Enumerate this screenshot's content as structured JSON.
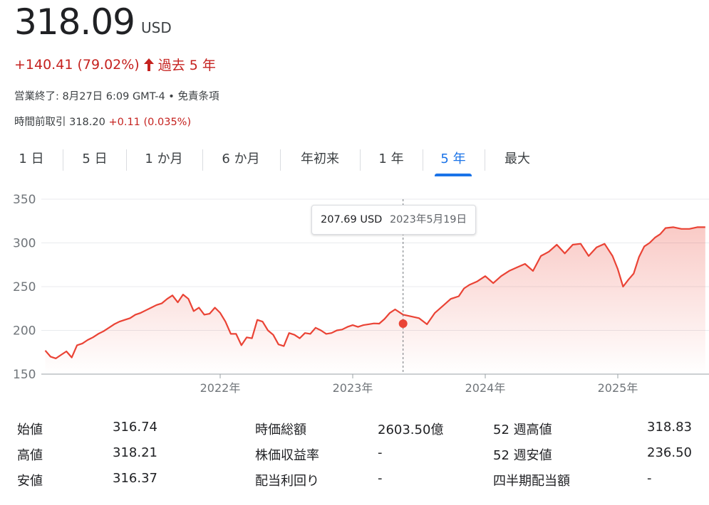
{
  "quote": {
    "price": "318.09",
    "currency": "USD",
    "change": "+140.41 (79.02%)",
    "period": "過去 5 年",
    "status": "営業終了: 8月27日 6:09 GMT-4 • 免責条項",
    "premarket_label": "時間前取引 318.20",
    "premarket_change": "+0.11 (0.035%)",
    "accent_up": "#c5221f"
  },
  "tabs": [
    {
      "label": "1 日"
    },
    {
      "label": "5 日"
    },
    {
      "label": "1 か月"
    },
    {
      "label": "6 か月"
    },
    {
      "label": "年初来"
    },
    {
      "label": "1 年"
    },
    {
      "label": "5 年",
      "active": true
    },
    {
      "label": "最大"
    }
  ],
  "tooltip": {
    "value": "207.69 USD",
    "date": "2023年5月19日"
  },
  "chart_data": {
    "type": "area",
    "x_tick_labels": [
      "2022年",
      "2023年",
      "2024年",
      "2025年"
    ],
    "y_tick_labels": [
      "350",
      "300",
      "250",
      "200",
      "150"
    ],
    "ylim": [
      150,
      350
    ],
    "grid": true,
    "line_color": "#ea4335",
    "highlight": {
      "x": 2023.38,
      "y": 207.69
    },
    "series": [
      {
        "x": [
          2020.68,
          2020.72,
          2020.76,
          2020.8,
          2020.84,
          2020.88,
          2020.92,
          2020.96,
          2021.0,
          2021.04,
          2021.08,
          2021.12,
          2021.16,
          2021.2,
          2021.24,
          2021.28,
          2021.32,
          2021.36,
          2021.4,
          2021.44,
          2021.48,
          2021.52,
          2021.56,
          2021.6,
          2021.64,
          2021.68,
          2021.72,
          2021.76,
          2021.8,
          2021.84,
          2021.88,
          2021.92,
          2021.96,
          2022.0,
          2022.04,
          2022.08,
          2022.12,
          2022.16,
          2022.2,
          2022.24,
          2022.28,
          2022.32,
          2022.36,
          2022.4,
          2022.44,
          2022.48,
          2022.52,
          2022.56,
          2022.6,
          2022.64,
          2022.68,
          2022.72,
          2022.76,
          2022.8,
          2022.84,
          2022.88,
          2022.92,
          2022.96,
          2023.0,
          2023.04,
          2023.08,
          2023.12,
          2023.16,
          2023.2,
          2023.24,
          2023.28,
          2023.32,
          2023.38,
          2023.44,
          2023.5,
          2023.56,
          2023.62,
          2023.68,
          2023.74,
          2023.8,
          2023.84,
          2023.88,
          2023.94,
          2024.0,
          2024.06,
          2024.12,
          2024.18,
          2024.24,
          2024.3,
          2024.36,
          2024.42,
          2024.48,
          2024.54,
          2024.6,
          2024.66,
          2024.72,
          2024.78,
          2024.84,
          2024.9,
          2024.96,
          2025.0,
          2025.04,
          2025.08,
          2025.12,
          2025.16,
          2025.2,
          2025.24,
          2025.28,
          2025.32,
          2025.36,
          2025.42,
          2025.48,
          2025.54,
          2025.6,
          2025.66
        ],
        "y": [
          177,
          170,
          168,
          172,
          176,
          169,
          183,
          185,
          189,
          192,
          196,
          199,
          203,
          207,
          210,
          212,
          214,
          218,
          220,
          223,
          226,
          229,
          231,
          236,
          240,
          232,
          241,
          236,
          222,
          226,
          218,
          219,
          226,
          220,
          210,
          196,
          196,
          183,
          192,
          191,
          212,
          210,
          200,
          195,
          184,
          182,
          197,
          195,
          191,
          197,
          196,
          203,
          200,
          196,
          197,
          200,
          201,
          204,
          206,
          204,
          206,
          207,
          208,
          207.69,
          213,
          220,
          224,
          218,
          216,
          214,
          207,
          220,
          228,
          236,
          239,
          248,
          252,
          256,
          262,
          254,
          262,
          268,
          272,
          276,
          268,
          285,
          290,
          298,
          288,
          298,
          299,
          285,
          295,
          299,
          285,
          270,
          250,
          258,
          265,
          284,
          296,
          300,
          306,
          310,
          317,
          318,
          316,
          316,
          318,
          318
        ]
      }
    ]
  },
  "stats": {
    "col1": [
      {
        "label": "始値",
        "value": "316.74"
      },
      {
        "label": "高値",
        "value": "318.21"
      },
      {
        "label": "安値",
        "value": "316.37"
      }
    ],
    "col2": [
      {
        "label": "時価総額",
        "value": "2603.50億"
      },
      {
        "label": "株価収益率",
        "value": "-"
      },
      {
        "label": "配当利回り",
        "value": "-"
      }
    ],
    "col3": [
      {
        "label": "52 週高値",
        "value": "318.83"
      },
      {
        "label": "52 週安値",
        "value": "236.50"
      },
      {
        "label": "四半期配当額",
        "value": "-"
      }
    ]
  }
}
